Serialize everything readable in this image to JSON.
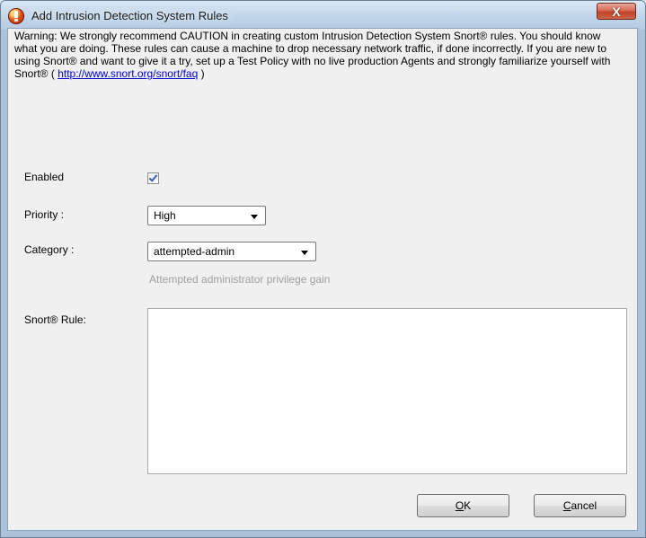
{
  "window": {
    "title": "Add Intrusion Detection System Rules",
    "close_label": "X"
  },
  "warning": {
    "text": "Warning: We strongly recommend CAUTION in creating custom Intrusion Detection System Snort® rules. You should know what you are doing. These rules can cause a machine to drop necessary network traffic, if done incorrectly. If you are new to using Snort® and want to give it a try, set up a Test Policy with no live production Agents and strongly familiarize yourself with Snort® ( ",
    "link": "http://www.snort.org/snort/faq",
    "suffix": " )"
  },
  "form": {
    "enabled_label": "Enabled",
    "enabled_checked": true,
    "priority_label": "Priority :",
    "priority_value": "High",
    "category_label": "Category :",
    "category_value": "attempted-admin",
    "category_description": "Attempted administrator privilege gain",
    "rule_label": "Snort® Rule:",
    "rule_value": ""
  },
  "buttons": {
    "ok_mnemonic": "O",
    "ok_rest": "K",
    "cancel_mnemonic": "C",
    "cancel_rest": "ancel"
  }
}
